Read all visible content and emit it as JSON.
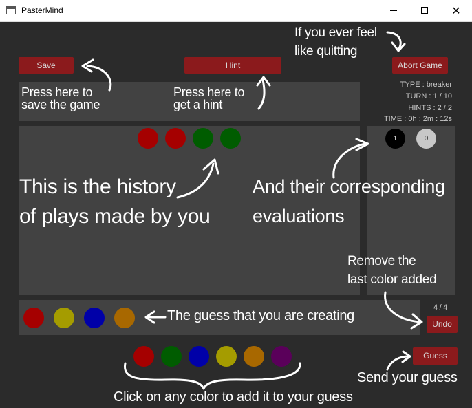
{
  "window": {
    "title": "PasterMind"
  },
  "toolbar": {
    "save": "Save",
    "hint": "Hint",
    "abort": "Abort Game"
  },
  "info": {
    "type": "TYPE : breaker",
    "turn": "TURN : 1 / 10",
    "hints": "HINTS : 2 / 2",
    "time": "TIME : 0h : 2m : 12s"
  },
  "history": {
    "colors": [
      "#a50000",
      "#a50000",
      "#005c00",
      "#005c00"
    ]
  },
  "evaluation": {
    "black": "1",
    "white": "0"
  },
  "guess": {
    "colors": [
      "#a50000",
      "#a59c00",
      "#0000a8",
      "#a86800"
    ],
    "count": "4 / 4",
    "undo": "Undo",
    "submit": "Guess"
  },
  "palette": [
    "#a50000",
    "#005c00",
    "#0000a8",
    "#a59c00",
    "#a86800",
    "#5a005a"
  ],
  "annotations": {
    "quit_1": "If you ever feel",
    "quit_2": "like quitting",
    "save_1": "Press here to",
    "save_2": "save the game",
    "hint_1": "Press here to",
    "hint_2": "get a hint",
    "history_1": "This is the history",
    "history_2": "of plays made by you",
    "eval_1": "And their corresponding",
    "eval_2": "evaluations",
    "remove_1": "Remove the",
    "remove_2": "last color added",
    "creating": "The guess that you are creating",
    "send": "Send your guess",
    "click": "Click on any color to add it to your guess"
  },
  "colors": {
    "button": "#8b1a1c",
    "panel": "#424242",
    "background": "#2b2b2b"
  }
}
